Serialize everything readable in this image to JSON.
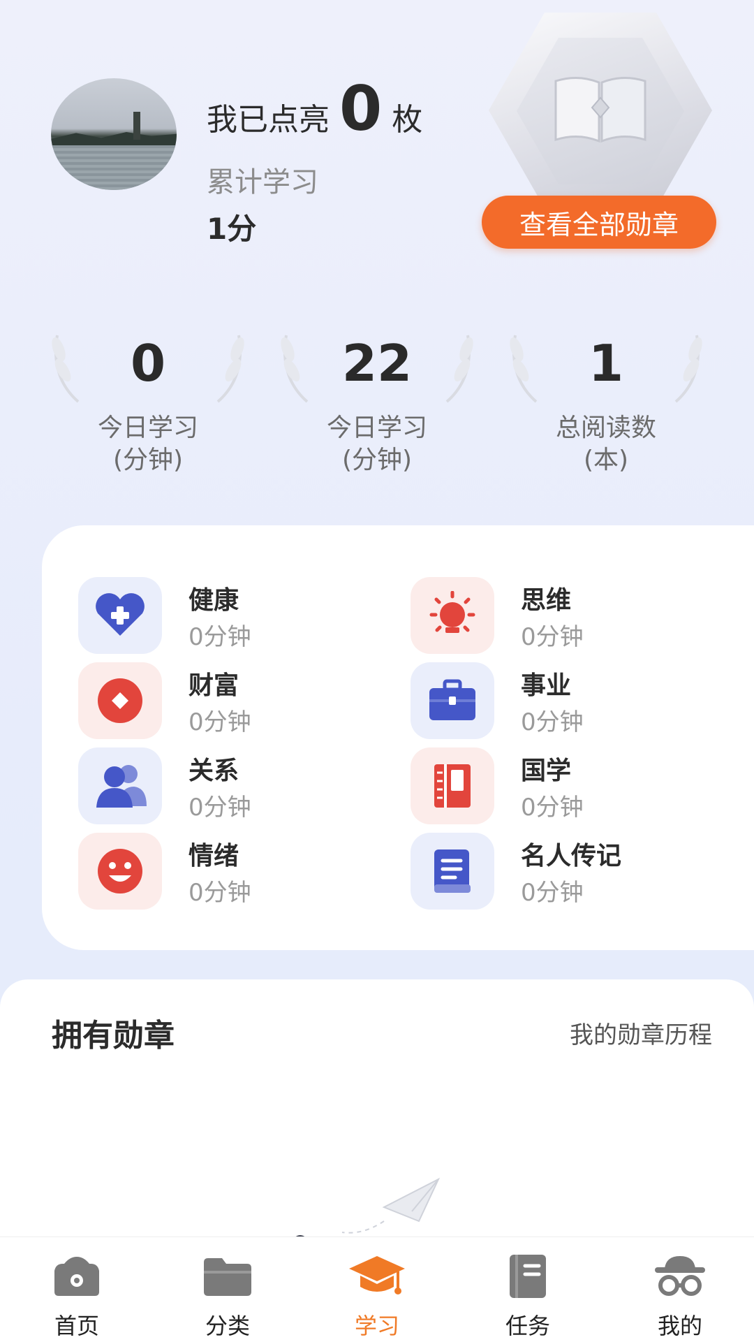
{
  "profile": {
    "lit_prefix": "我已点亮",
    "lit_count": "0",
    "lit_suffix": "枚",
    "accumulated_label": "累计学习",
    "accumulated_value": "1分"
  },
  "badge_button": "查看全部勋章",
  "stats": [
    {
      "value": "0",
      "label_line1": "今日学习",
      "label_line2": "(分钟)"
    },
    {
      "value": "22",
      "label_line1": "今日学习",
      "label_line2": "(分钟)"
    },
    {
      "value": "1",
      "label_line1": "总阅读数",
      "label_line2": "(本)"
    }
  ],
  "categories": [
    {
      "name": "健康",
      "minutes": "0分钟",
      "icon": "heart-plus-icon",
      "color": "#4557c8"
    },
    {
      "name": "思维",
      "minutes": "0分钟",
      "icon": "lightbulb-icon",
      "color": "#e2453c"
    },
    {
      "name": "财富",
      "minutes": "0分钟",
      "icon": "coin-icon",
      "color": "#e2453c"
    },
    {
      "name": "事业",
      "minutes": "0分钟",
      "icon": "briefcase-icon",
      "color": "#4557c8"
    },
    {
      "name": "关系",
      "minutes": "0分钟",
      "icon": "people-icon",
      "color": "#4557c8"
    },
    {
      "name": "国学",
      "minutes": "0分钟",
      "icon": "book-bound-icon",
      "color": "#e2453c"
    },
    {
      "name": "情绪",
      "minutes": "0分钟",
      "icon": "smile-icon",
      "color": "#e2453c"
    },
    {
      "name": "名人传记",
      "minutes": "0分钟",
      "icon": "notebook-icon",
      "color": "#4557c8"
    }
  ],
  "owned": {
    "title": "拥有勋章",
    "link": "我的勋章历程"
  },
  "nav": [
    {
      "label": "首页",
      "icon": "home-camera-icon"
    },
    {
      "label": "分类",
      "icon": "folder-icon"
    },
    {
      "label": "学习",
      "icon": "graduation-cap-icon",
      "active": true
    },
    {
      "label": "任务",
      "icon": "task-book-icon"
    },
    {
      "label": "我的",
      "icon": "profile-glasses-icon"
    }
  ],
  "colors": {
    "accent": "#f36b2a",
    "blue": "#4557c8",
    "red": "#e2453c",
    "active_nav": "#f07a26"
  }
}
